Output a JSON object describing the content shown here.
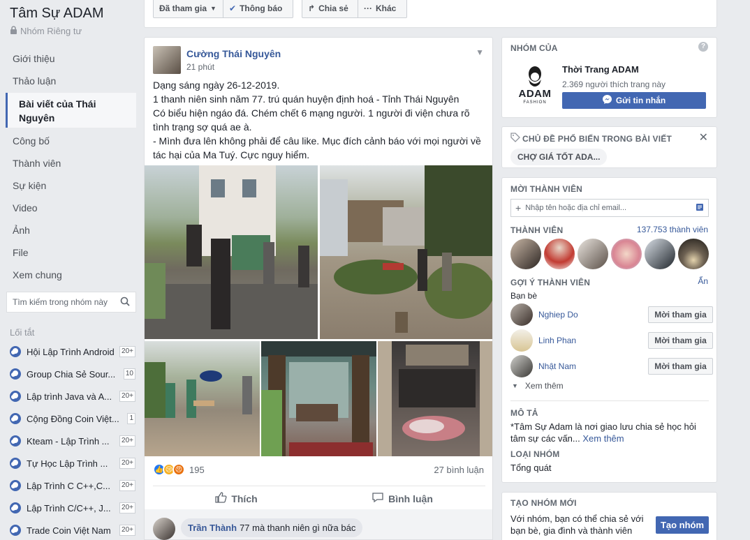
{
  "group": {
    "title": "Tâm Sự ADAM",
    "privacy": "Nhóm Riêng tư"
  },
  "nav": [
    "Giới thiệu",
    "Thảo luận",
    "Bài viết của Thái Nguyên",
    "Công bố",
    "Thành viên",
    "Sự kiện",
    "Video",
    "Ảnh",
    "File",
    "Xem chung"
  ],
  "sidebar_search": {
    "placeholder": "Tìm kiếm trong nhóm này"
  },
  "shortcuts": {
    "title": "Lối tắt",
    "items": [
      {
        "name": "Hội Lập Trình Android",
        "badge": "20+"
      },
      {
        "name": "Group Chia Sẻ Sour...",
        "badge": "10"
      },
      {
        "name": "Lập trình Java và A...",
        "badge": "20+"
      },
      {
        "name": "Cộng Đồng Coin Việt...",
        "badge": "1"
      },
      {
        "name": "Kteam - Lập Trình ...",
        "badge": "20+"
      },
      {
        "name": "Tự Học Lập Trình ...",
        "badge": "20+"
      },
      {
        "name": "Lập Trình C C++,C...",
        "badge": "20+"
      },
      {
        "name": "Lập Trình C/C++, J...",
        "badge": "20+"
      },
      {
        "name": "Trade Coin Việt Nam",
        "badge": "20+"
      }
    ]
  },
  "topbar": {
    "joined": "Đã tham gia",
    "notify": "Thông báo",
    "share": "Chia sẻ",
    "more": "Khác"
  },
  "post": {
    "author": "Cường Thái Nguyên",
    "time": "21 phút",
    "lines": [
      "Dạng sáng ngày 26-12-2019.",
      "1 thanh niên sinh năm 77. trú quán huyện định hoá - Tỉnh Thái Nguyên",
      "Có biểu hiện ngáo đá. Chém chết 6 mạng người. 1 người đi viện chưa rõ tình trạng sợ quá ae à.",
      "- Mình đưa lên không phải để câu like. Mục đích cảnh báo với mọi người về tác hại của Ma Tuý. Cực nguy hiểm."
    ],
    "reaction_count": "195",
    "comment_count": "27 bình luận",
    "like_label": "Thích",
    "comment_label": "Bình luận"
  },
  "comment": {
    "author": "Trần Thành",
    "text": "77 mà thanh niên gì nữa bác"
  },
  "owner_card": {
    "header": "NHÓM CỦA",
    "page_name": "Thời Trang ADAM",
    "likes": "2.369 người thích trang này",
    "send_message": "Gửi tin nhắn",
    "logo_text": "ADAM",
    "logo_sub": "FASHION"
  },
  "topics_card": {
    "header": "CHỦ ĐỀ PHỔ BIẾN TRONG BÀI VIẾT",
    "topic": "CHỢ GIÁ TỐT ADA..."
  },
  "invite_card": {
    "header": "MỜI THÀNH VIÊN",
    "input_placeholder": "Nhập tên hoặc địa chỉ email...",
    "members_label": "THÀNH VIÊN",
    "members_count": "137.753 thành viên",
    "suggest_label": "GỢI Ý THÀNH VIÊN",
    "hide": "Ẩn",
    "friends_label": "Bạn bè",
    "suggestions": [
      {
        "name": "Nghiep Do",
        "button": "Mời tham gia"
      },
      {
        "name": "Linh Phan",
        "button": "Mời tham gia"
      },
      {
        "name": "Nhật Nam",
        "button": "Mời tham gia"
      }
    ],
    "see_more": "Xem thêm",
    "desc_label": "MÔ TẢ",
    "desc_text": "*Tâm Sự Adam là nơi giao lưu chia sẻ học hỏi tâm sự các vấn...",
    "desc_more": "Xem thêm",
    "type_label": "LOẠI NHÓM",
    "type_value": "Tổng quát"
  },
  "create_card": {
    "header": "TẠO NHÓM MỚI",
    "text": "Với nhóm, bạn có thể chia sẻ với bạn bè, gia đình và thành viên",
    "button": "Tạo nhóm"
  },
  "colors": {
    "brand": "#4267b2",
    "link": "#365899",
    "background": "#e9ebee"
  }
}
